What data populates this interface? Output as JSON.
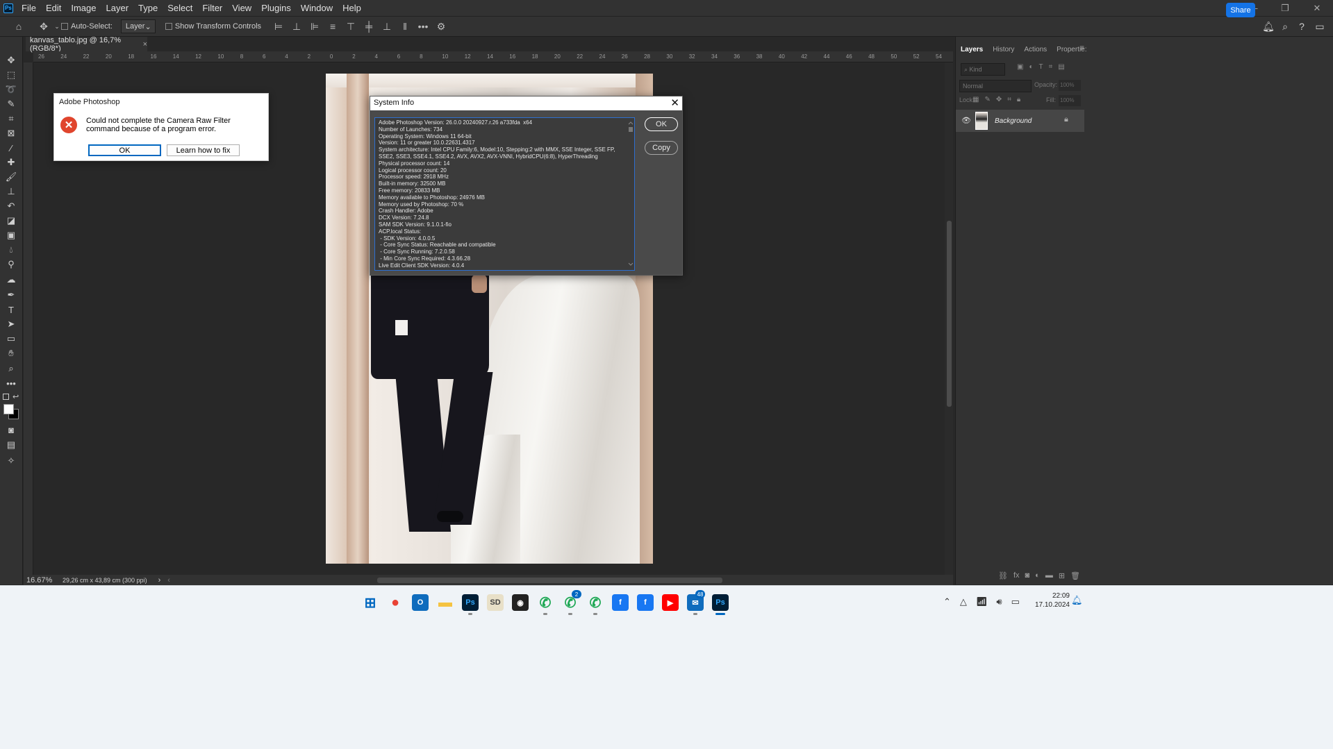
{
  "menubar": {
    "logo": "Ps",
    "items": [
      "File",
      "Edit",
      "Image",
      "Layer",
      "Type",
      "Select",
      "Filter",
      "View",
      "Plugins",
      "Window",
      "Help"
    ]
  },
  "options": {
    "auto_select_label": "Auto-Select:",
    "auto_select_value": "Layer",
    "transform_label": "Show Transform Controls",
    "share_label": "Share"
  },
  "document": {
    "tab_label": "kanvas_tablo.jpg @ 16,7% (RGB/8*)",
    "zoom": "16.67%",
    "dimensions": "29,26 cm x 43,89 cm (300 ppi)"
  },
  "ruler_h": [
    "26",
    "24",
    "22",
    "20",
    "18",
    "16",
    "14",
    "12",
    "10",
    "8",
    "6",
    "4",
    "2",
    "0",
    "2",
    "4",
    "6",
    "8",
    "10",
    "12",
    "14",
    "16",
    "18",
    "20",
    "22",
    "24",
    "26",
    "28",
    "30",
    "32",
    "34",
    "36",
    "38",
    "40",
    "42",
    "44",
    "46",
    "48",
    "50",
    "52",
    "54"
  ],
  "panel": {
    "tabs": [
      "Layers",
      "History",
      "Actions",
      "Propertie:"
    ],
    "filter_placeholder": "Kind",
    "blend_mode": "Normal",
    "opacity_label": "Opacity:",
    "opacity_value": "100%",
    "lock_label": "Lock:",
    "fill_label": "Fill:",
    "fill_value": "100%",
    "layer_name": "Background"
  },
  "error_dialog": {
    "title": "Adobe Photoshop",
    "message": "Could not complete the Camera Raw Filter command because of a program error.",
    "ok_label": "OK",
    "learn_label": "Learn how to fix"
  },
  "system_info": {
    "title": "System Info",
    "ok_label": "OK",
    "copy_label": "Copy",
    "lines": [
      "Adobe Photoshop Version: 26.0.0 20240927.r.26 a733fda  x64",
      "Number of Launches: 734",
      "Operating System: Windows 11 64-bit",
      "Version: 11 or greater 10.0.22631.4317",
      "System architecture: Intel CPU Family:6, Model:10, Stepping:2 with MMX, SSE Integer, SSE FP,",
      "SSE2, SSE3, SSE4.1, SSE4.2, AVX, AVX2, AVX-VNNI, HybridCPU(6:8), HyperThreading",
      "Physical processor count: 14",
      "Logical processor count: 20",
      "Processor speed: 2918 MHz",
      "Built-in memory: 32500 MB",
      "Free memory: 20833 MB",
      "Memory available to Photoshop: 24976 MB",
      "Memory used by Photoshop: 70 %",
      "Crash Handler: Adobe",
      "DCX Version: 7.24.8",
      "SAM SDK Version: 9.1.0.1-fio",
      "ACP.local Status:",
      " - SDK Version: 4.0.0.5",
      " - Core Sync Status: Reachable and compatible",
      " - Core Sync Running: 7.2.0.58",
      " - Min Core Sync Required: 4.3.66.28",
      "Live Edit Client SDK Version: 4.0.4"
    ]
  },
  "taskbar": {
    "apps": [
      {
        "name": "windows-start",
        "glyph": "⊞",
        "color": "#0067c0",
        "bg": "transparent"
      },
      {
        "name": "chrome",
        "glyph": "●",
        "color": "#e94235",
        "bg": "transparent"
      },
      {
        "name": "outlook",
        "glyph": "O",
        "color": "#ffffff",
        "bg": "#0f6cbd"
      },
      {
        "name": "file-explorer",
        "glyph": "▬",
        "color": "#f5c342",
        "bg": "transparent"
      },
      {
        "name": "photoshop",
        "glyph": "Ps",
        "color": "#31a8ff",
        "bg": "#001e36"
      },
      {
        "name": "app-sd",
        "glyph": "SD",
        "color": "#444444",
        "bg": "#e8e0c8"
      },
      {
        "name": "davinci",
        "glyph": "◉",
        "color": "#ffffff",
        "bg": "#222222"
      },
      {
        "name": "whatsapp-1",
        "glyph": "✆",
        "color": "#1fa855",
        "bg": "transparent"
      },
      {
        "name": "whatsapp-2",
        "glyph": "✆",
        "color": "#1fa855",
        "bg": "transparent"
      },
      {
        "name": "whatsapp-3",
        "glyph": "✆",
        "color": "#1fa855",
        "bg": "transparent"
      },
      {
        "name": "facebook-1",
        "glyph": "f",
        "color": "#ffffff",
        "bg": "#1877f2"
      },
      {
        "name": "facebook-2",
        "glyph": "f",
        "color": "#ffffff",
        "bg": "#1877f2"
      },
      {
        "name": "youtube",
        "glyph": "▶",
        "color": "#ffffff",
        "bg": "#ff0000"
      },
      {
        "name": "mail",
        "glyph": "✉",
        "color": "#ffffff",
        "bg": "#0f6cbd"
      },
      {
        "name": "photoshop-active",
        "glyph": "Ps",
        "color": "#31a8ff",
        "bg": "#001e36"
      }
    ],
    "badge_whatsapp": "2",
    "badge_mail": "48",
    "time": "22:09",
    "date": "17.10.2024"
  }
}
